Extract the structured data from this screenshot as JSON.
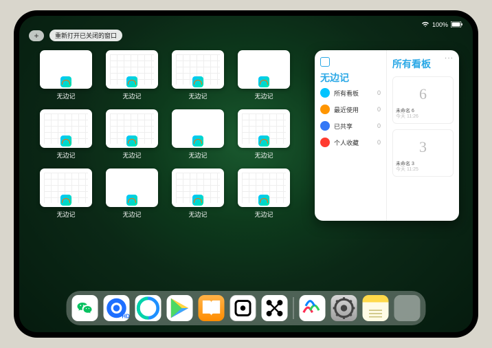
{
  "status": {
    "battery": "100%"
  },
  "topbar": {
    "add_label": "+",
    "reopen_label": "重新打开已关闭的窗口"
  },
  "app_name": "无边记",
  "thumbs": [
    {
      "style": "blank"
    },
    {
      "style": "grid"
    },
    {
      "style": "grid"
    },
    {
      "style": "blank"
    },
    {
      "style": "grid"
    },
    {
      "style": "grid"
    },
    {
      "style": "blank"
    },
    {
      "style": "grid"
    },
    {
      "style": "grid"
    },
    {
      "style": "blank"
    },
    {
      "style": "grid"
    },
    {
      "style": "grid"
    }
  ],
  "panel": {
    "more": "···",
    "left_title": "无边记",
    "right_title": "所有看板",
    "sidebar": [
      {
        "label": "所有看板",
        "count": 0,
        "color": "#00c4ff"
      },
      {
        "label": "最近使用",
        "count": 0,
        "color": "#ff9500"
      },
      {
        "label": "已共享",
        "count": 0,
        "color": "#3478f6"
      },
      {
        "label": "个人收藏",
        "count": 0,
        "color": "#ff3b30"
      }
    ],
    "boards": [
      {
        "drawing": "6",
        "title": "未命名 6",
        "subtitle": "今天 11:26"
      },
      {
        "drawing": "3",
        "title": "未命名 3",
        "subtitle": "今天 11:25"
      }
    ]
  },
  "dock": [
    {
      "id": "wechat",
      "name": "wechat-icon"
    },
    {
      "id": "qqhd",
      "name": "qq-hd-icon"
    },
    {
      "id": "qq",
      "name": "qq-browser-icon"
    },
    {
      "id": "play",
      "name": "play-icon"
    },
    {
      "id": "books",
      "name": "books-icon"
    },
    {
      "id": "die",
      "name": "die-icon"
    },
    {
      "id": "dots",
      "name": "connect-icon"
    },
    {
      "id": "sep"
    },
    {
      "id": "freeform",
      "name": "freeform-icon"
    },
    {
      "id": "settings",
      "name": "settings-icon"
    },
    {
      "id": "notes",
      "name": "notes-icon"
    },
    {
      "id": "grid4",
      "name": "app-library-icon"
    }
  ]
}
